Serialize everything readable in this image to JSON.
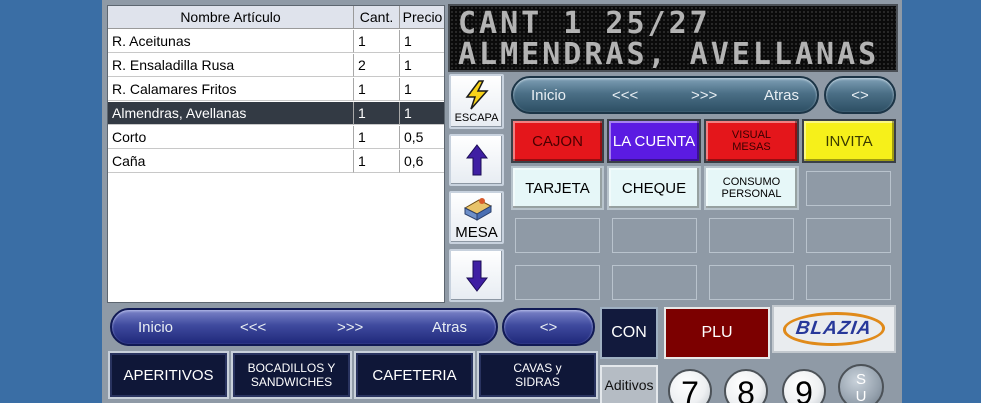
{
  "table": {
    "headers": [
      "Nombre Artículo",
      "Cant.",
      "Precio"
    ],
    "rows": [
      {
        "name": "R. Aceitunas",
        "qty": "1",
        "price": "1"
      },
      {
        "name": "R. Ensaladilla Rusa",
        "qty": "2",
        "price": "1"
      },
      {
        "name": "R. Calamares Fritos",
        "qty": "1",
        "price": "1"
      },
      {
        "name": "Almendras, Avellanas",
        "qty": "1",
        "price": "1"
      },
      {
        "name": "Corto",
        "qty": "1",
        "price": "0,5"
      },
      {
        "name": "Caña",
        "qty": "1",
        "price": "0,6"
      }
    ],
    "selected_index": 3
  },
  "display": {
    "line1": "CANT 1   25/27",
    "line2": "ALMENDRAS, AVELLANAS"
  },
  "side_buttons": {
    "escape_label": "ESCAPA",
    "mesa_label": "MESA"
  },
  "nav_top": {
    "inicio": "Inicio",
    "prev": "<<<",
    "next": ">>>",
    "atras": "Atras",
    "toggle": "<>"
  },
  "nav_bottom": {
    "inicio": "Inicio",
    "prev": "<<<",
    "next": ">>>",
    "atras": "Atras",
    "toggle": "<>"
  },
  "function_buttons": {
    "cajon": "CAJON",
    "la_cuenta": "LA CUENTA",
    "visual_mesas_1": "VISUAL",
    "visual_mesas_2": "MESAS",
    "invita": "INVITA",
    "tarjeta": "TARJETA",
    "cheque": "CHEQUE",
    "consumo_1": "CONSUMO",
    "consumo_2": "PERSONAL"
  },
  "controls": {
    "con": "CON",
    "plu": "PLU",
    "logo": "BLAZIA",
    "aditivos": "Aditivos"
  },
  "categories": {
    "aperitivos": "APERITIVOS",
    "bocadillos_1": "BOCADILLOS Y",
    "bocadillos_2": "SANDWICHES",
    "cafeteria": "CAFETERIA",
    "cavas_1": "CAVAS y",
    "cavas_2": "SIDRAS"
  },
  "numpad": {
    "seven": "7",
    "eight": "8",
    "nine": "9",
    "su_1": "S",
    "su_2": "U"
  },
  "colors": {
    "background": "#3a6ea5",
    "cajon": "#e4161b",
    "la_cuenta": "#5b1be2",
    "invita": "#f6f01a",
    "plu": "#7c0000",
    "selected_row": "#333a44"
  }
}
